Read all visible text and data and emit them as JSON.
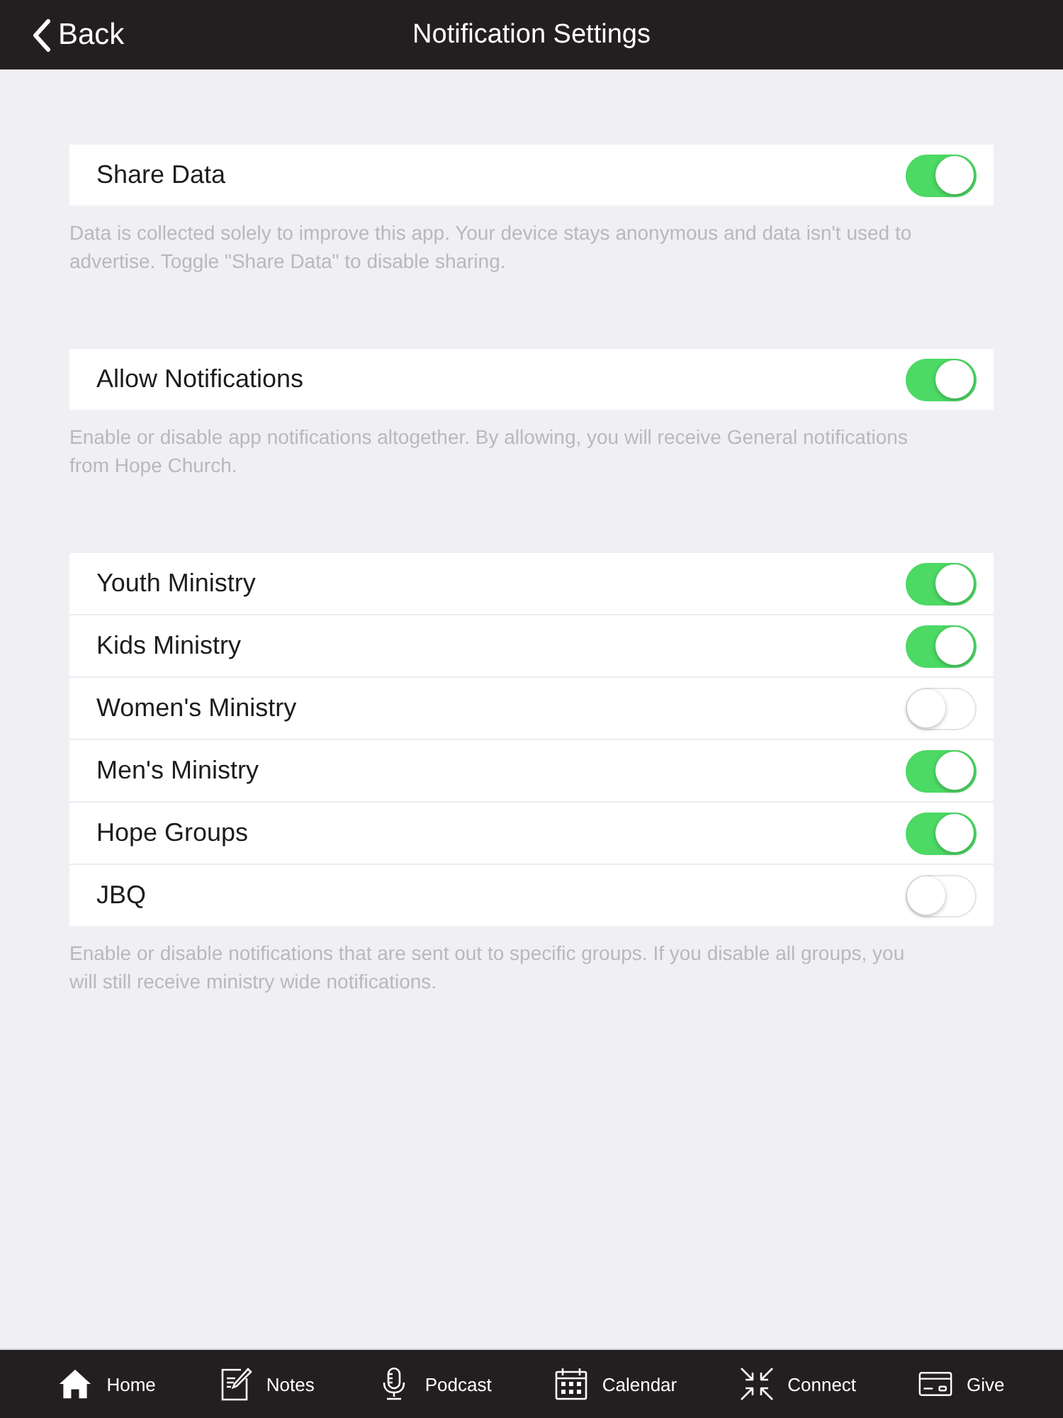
{
  "nav_bar": {
    "back_label": "Back",
    "title": "Notification Settings"
  },
  "sections": [
    {
      "rows": [
        {
          "label": "Share Data",
          "on": true
        }
      ],
      "footer": "Data is collected solely to improve this app. Your device stays anonymous and data isn't used to advertise. Toggle \"Share Data\" to disable sharing."
    },
    {
      "rows": [
        {
          "label": "Allow Notifications",
          "on": true
        }
      ],
      "footer": "Enable or disable app notifications altogether. By allowing, you will receive General notifications from Hope Church."
    },
    {
      "rows": [
        {
          "label": "Youth Ministry",
          "on": true
        },
        {
          "label": "Kids Ministry",
          "on": true
        },
        {
          "label": "Women's Ministry",
          "on": false
        },
        {
          "label": "Men's Ministry",
          "on": true
        },
        {
          "label": "Hope Groups",
          "on": true
        },
        {
          "label": "JBQ",
          "on": false
        }
      ],
      "footer": "Enable or disable notifications that are sent out to specific groups. If you disable all groups, you will still receive ministry wide notifications."
    }
  ],
  "tab_bar": [
    {
      "label": "Home",
      "kind": "home"
    },
    {
      "label": "Notes",
      "kind": "notes"
    },
    {
      "label": "Podcast",
      "kind": "podcast"
    },
    {
      "label": "Calendar",
      "kind": "calendar"
    },
    {
      "label": "Connect",
      "kind": "connect"
    },
    {
      "label": "Give",
      "kind": "give"
    }
  ]
}
